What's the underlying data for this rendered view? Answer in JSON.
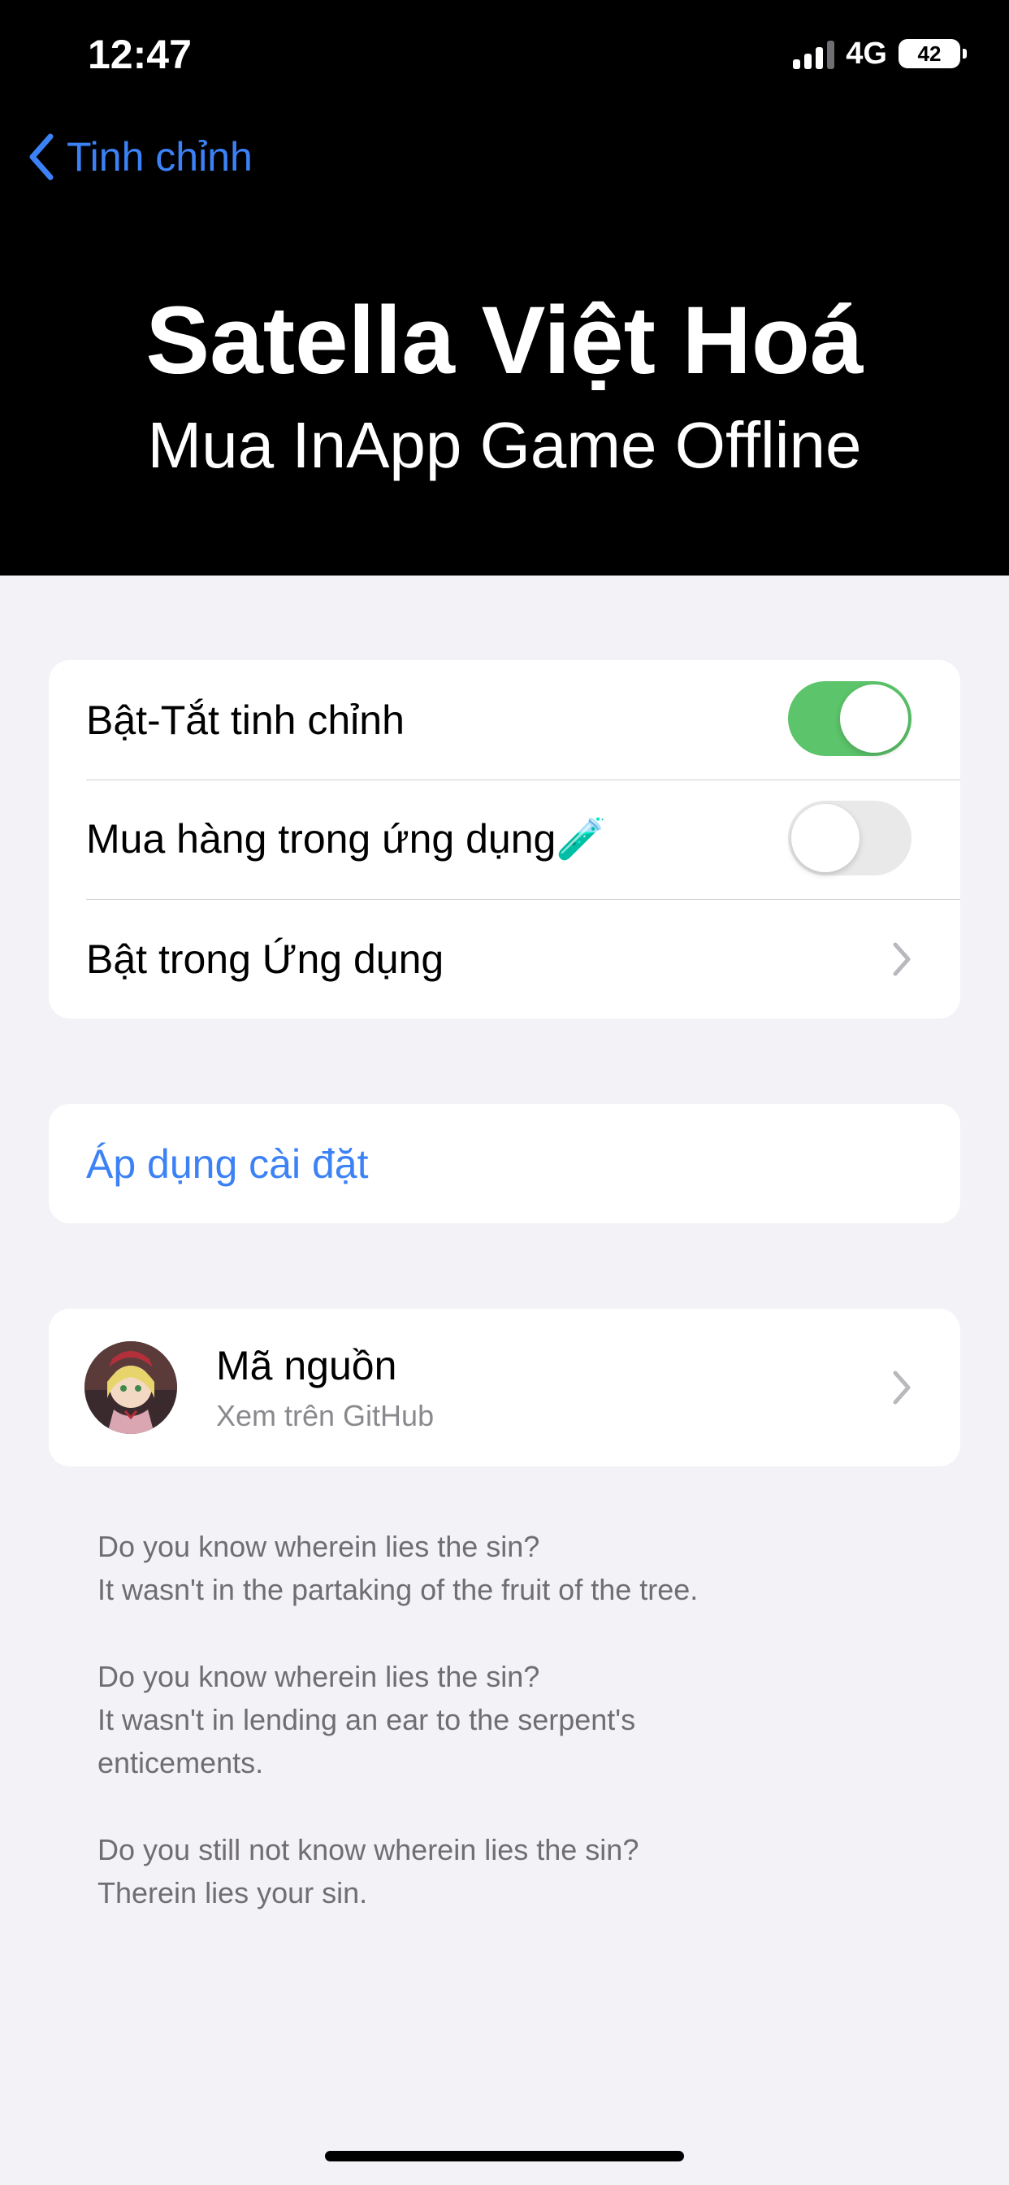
{
  "status_bar": {
    "time": "12:47",
    "network": "4G",
    "battery": "42"
  },
  "nav": {
    "back_label": "Tinh chỉnh"
  },
  "hero": {
    "title": "Satella Việt Hoá",
    "subtitle": "Mua InApp Game Offline"
  },
  "settings": {
    "items": [
      {
        "label": "Bật-Tắt tinh chỉnh",
        "control": "toggle",
        "on": true
      },
      {
        "label": "Mua hàng trong ứng dụng🧪",
        "control": "toggle",
        "on": false
      },
      {
        "label": "Bật trong Ứng dụng",
        "control": "chevron"
      }
    ]
  },
  "apply": {
    "label": "Áp dụng cài đặt"
  },
  "source": {
    "title": "Mã nguồn",
    "subtitle": "Xem trên GitHub"
  },
  "footer": {
    "paragraphs": [
      "Do you know wherein lies the sin?\nIt wasn't in the partaking of the fruit of the tree.",
      "Do you know wherein lies the sin?\nIt wasn't in lending an ear to the serpent's\nenticements.",
      "Do you still not know wherein lies the sin?\nTherein lies your sin."
    ]
  },
  "colors": {
    "accent": "#3c82f6",
    "toggle_on": "#5cc46a",
    "background": "#f2f2f7"
  }
}
